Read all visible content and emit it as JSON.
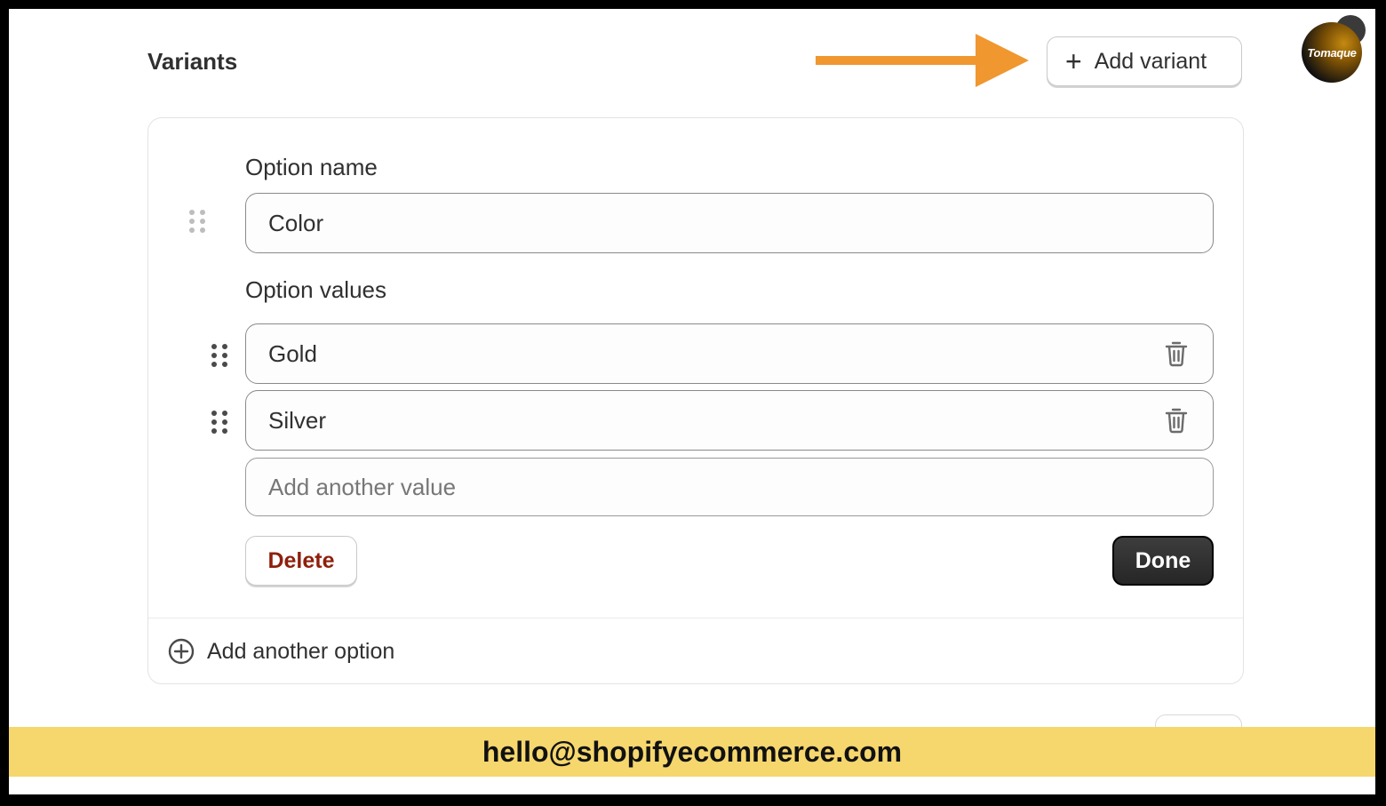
{
  "variants": {
    "title": "Variants",
    "add_variant_label": "Add variant",
    "arrow_color": "#f0972f"
  },
  "logo": {
    "text": "Tomaque"
  },
  "option": {
    "name_label": "Option name",
    "name_value": "Color",
    "values_label": "Option values",
    "values": [
      "Gold",
      "Silver"
    ],
    "new_value_placeholder": "Add another value",
    "delete_label": "Delete",
    "done_label": "Done"
  },
  "add_option_label": "Add another option",
  "banner": {
    "email": "hello@shopifyecommerce.com",
    "color": "#f5d76e"
  }
}
